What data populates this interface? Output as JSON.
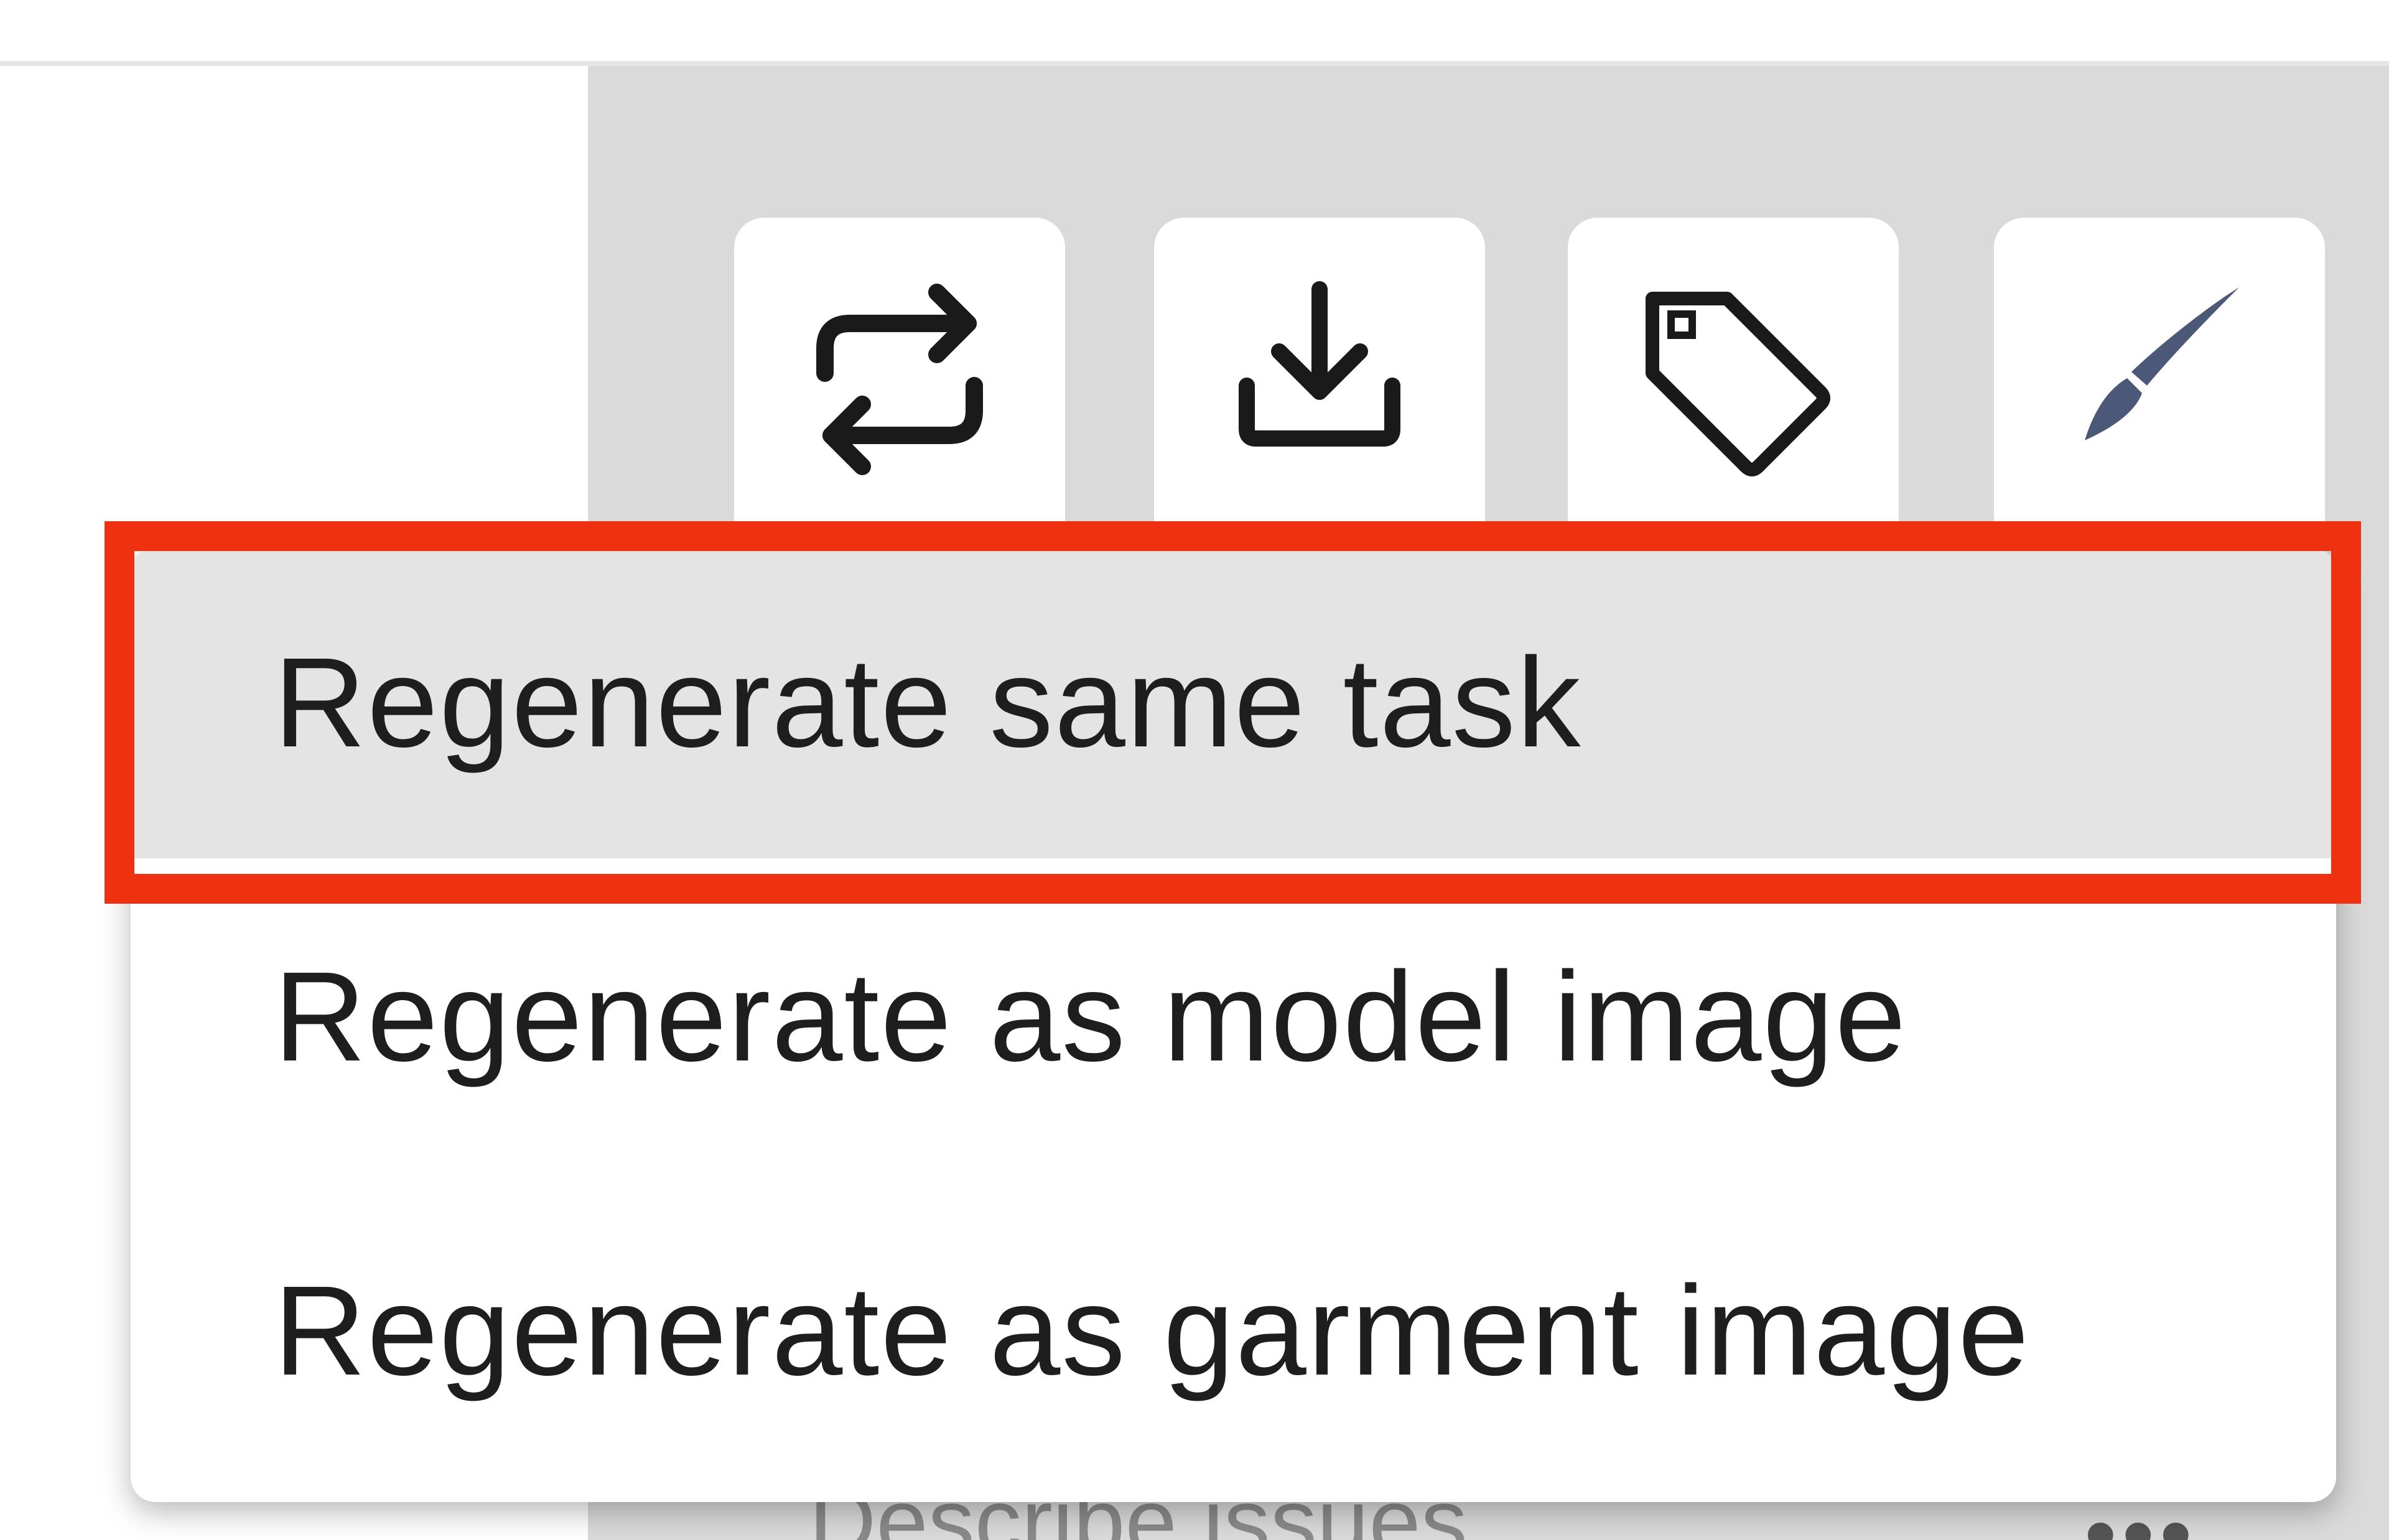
{
  "toolbar": {
    "buttons": [
      {
        "name": "regenerate",
        "icon": "repeat-icon"
      },
      {
        "name": "download",
        "icon": "download-icon"
      },
      {
        "name": "tag",
        "icon": "tag-icon"
      },
      {
        "name": "edit",
        "icon": "brush-icon"
      }
    ],
    "brush_color": "#4c5878"
  },
  "menu": {
    "items": [
      {
        "label": "Regenerate same task",
        "highlighted": true
      },
      {
        "label": "Regenerate as model image",
        "highlighted": false
      },
      {
        "label": "Regenerate as garment image",
        "highlighted": false
      }
    ]
  },
  "annotation": {
    "highlight_color": "#ee3211"
  },
  "issues_field": {
    "placeholder": "Describe issues",
    "more_label": "•••"
  }
}
